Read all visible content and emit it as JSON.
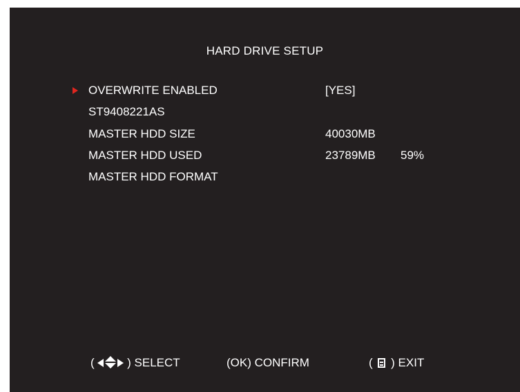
{
  "screen": {
    "title": "HARD DRIVE SETUP"
  },
  "menu": {
    "items": [
      {
        "label": "OVERWRITE ENABLED",
        "value": "[YES]",
        "value2": "",
        "selected": true
      },
      {
        "label": "ST9408221AS",
        "value": "",
        "value2": "",
        "selected": false
      },
      {
        "label": "MASTER HDD SIZE",
        "value": "40030MB",
        "value2": "",
        "selected": false
      },
      {
        "label": "MASTER HDD USED",
        "value": "23789MB",
        "value2": "59%",
        "selected": false
      },
      {
        "label": "MASTER HDD FORMAT",
        "value": "",
        "value2": "",
        "selected": false
      }
    ]
  },
  "footer": {
    "select_open": "(",
    "select_close": ")",
    "select_label": "SELECT",
    "confirm_key": "(OK)",
    "confirm_label": "CONFIRM",
    "exit_open": "(",
    "exit_close": ")",
    "exit_label": "EXIT"
  },
  "icons": {
    "cursor": "right-triangle-icon",
    "select_left": "left-arrow-icon",
    "select_updown": "up-down-arrow-icon",
    "select_right": "right-arrow-icon",
    "exit": "menu-icon"
  },
  "colors": {
    "background": "#231f20",
    "text": "#ffffff",
    "cursor": "#e0261f"
  }
}
